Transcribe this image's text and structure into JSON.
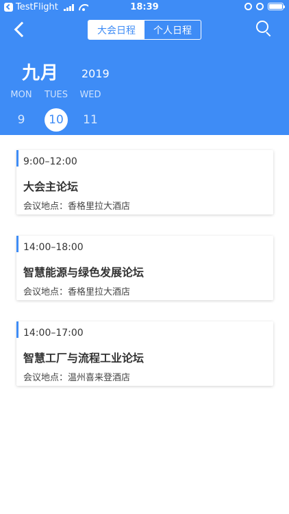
{
  "status_bar": {
    "carrier": "TestFlight",
    "time": "18:39"
  },
  "header": {
    "tabs": [
      {
        "label": "大会日程",
        "active": true
      },
      {
        "label": "个人日程",
        "active": false
      }
    ],
    "month": "九月",
    "year": "2019",
    "days": [
      {
        "dow": "MON",
        "num": "9",
        "selected": false
      },
      {
        "dow": "TUES",
        "num": "10",
        "selected": true
      },
      {
        "dow": "WED",
        "num": "11",
        "selected": false
      }
    ],
    "accent_color": "#3e8cf6"
  },
  "sessions": [
    {
      "time": "9:00–12:00",
      "title": "大会主论坛",
      "venue": "会议地点：香格里拉大酒店"
    },
    {
      "time": "14:00–18:00",
      "title": "智慧能源与绿色发展论坛",
      "venue": "会议地点：香格里拉大酒店"
    },
    {
      "time": "14:00–17:00",
      "title": "智慧工厂与流程工业论坛",
      "venue": "会议地点：温州喜来登酒店"
    }
  ]
}
